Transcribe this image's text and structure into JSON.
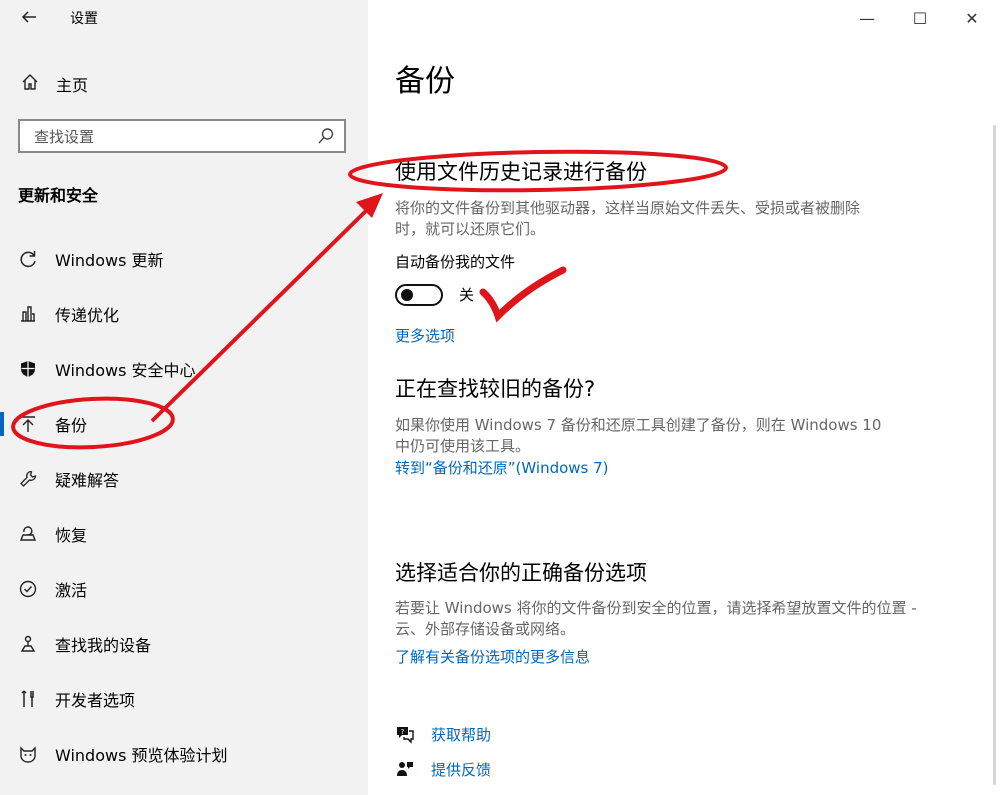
{
  "window": {
    "title": "设置",
    "back_icon": "back-arrow-icon",
    "minimize_glyph": "—",
    "maximize_glyph": "☐",
    "close_glyph": "✕"
  },
  "sidebar": {
    "home_label": "主页",
    "search_placeholder": "查找设置",
    "section_title": "更新和安全",
    "items": [
      {
        "label": "Windows 更新",
        "icon": "refresh-icon"
      },
      {
        "label": "传递优化",
        "icon": "delivery-optimization-icon"
      },
      {
        "label": "Windows 安全中心",
        "icon": "shield-icon"
      },
      {
        "label": "备份",
        "icon": "backup-arrow-icon",
        "selected": true
      },
      {
        "label": "疑难解答",
        "icon": "wrench-icon"
      },
      {
        "label": "恢复",
        "icon": "recovery-icon"
      },
      {
        "label": "激活",
        "icon": "check-circle-icon"
      },
      {
        "label": "查找我的设备",
        "icon": "find-device-icon"
      },
      {
        "label": "开发者选项",
        "icon": "developer-tools-icon"
      },
      {
        "label": "Windows 预览体验计划",
        "icon": "insider-cat-icon"
      }
    ]
  },
  "main": {
    "title": "备份",
    "file_history": {
      "heading": "使用文件历史记录进行备份",
      "desc_line1": "将你的文件备份到其他驱动器，这样当原始文件丢失、受损或者被删除",
      "desc_line2": "时，就可以还原它们。",
      "toggle_label": "自动备份我的文件",
      "toggle_state": "关",
      "more_options": "更多选项"
    },
    "older_backup": {
      "heading": "正在查找较旧的备份?",
      "desc_line1": "如果你使用 Windows 7 备份和还原工具创建了备份，则在 Windows 10",
      "desc_line2": "中仍可使用该工具。",
      "link": "转到“备份和还原”(Windows 7)"
    },
    "choose_backup": {
      "heading": "选择适合你的正确备份选项",
      "desc_line1": "若要让 Windows 将你的文件备份到安全的位置，请选择希望放置文件的位置 -",
      "desc_line2": "云、外部存储设备或网络。",
      "link": "了解有关备份选项的更多信息"
    },
    "help": {
      "get_help": "获取帮助",
      "feedback": "提供反馈"
    }
  },
  "colors": {
    "accent": "#0067c0",
    "annotation": "#e0151c",
    "sidebar_bg": "#f2f2f2"
  }
}
